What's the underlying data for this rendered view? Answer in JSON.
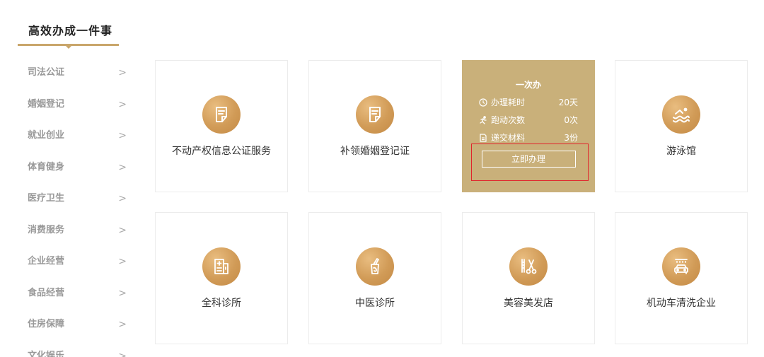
{
  "header": {
    "title": "高效办成一件事"
  },
  "sidebar": {
    "items": [
      {
        "label": "司法公证"
      },
      {
        "label": "婚姻登记"
      },
      {
        "label": "就业创业"
      },
      {
        "label": "体育健身"
      },
      {
        "label": "医疗卫生"
      },
      {
        "label": "消费服务"
      },
      {
        "label": "企业经营"
      },
      {
        "label": "食品经营"
      },
      {
        "label": "住房保障"
      },
      {
        "label": "文化娱乐"
      }
    ],
    "chevron": ">"
  },
  "cards": [
    {
      "label": "不动产权信息公证服务",
      "icon": "document-icon"
    },
    {
      "label": "补领婚姻登记证",
      "icon": "document-icon"
    },
    {
      "active": true,
      "title": "一次办",
      "rows": [
        {
          "label": "办理耗时",
          "value": "20天",
          "icon": "clock-icon"
        },
        {
          "label": "跑动次数",
          "value": "0次",
          "icon": "running-icon"
        },
        {
          "label": "递交材料",
          "value": "3份",
          "icon": "file-icon"
        }
      ],
      "button": "立即办理"
    },
    {
      "label": "游泳馆",
      "icon": "swimming-icon"
    },
    {
      "label": "全科诊所",
      "icon": "clinic-icon"
    },
    {
      "label": "中医诊所",
      "icon": "herbal-medicine-icon"
    },
    {
      "label": "美容美发店",
      "icon": "scissors-icon"
    },
    {
      "label": "机动车清洗企业",
      "icon": "car-wash-icon"
    }
  ],
  "colors": {
    "accent": "#c9a66b",
    "active_card": "#c9b07a",
    "highlight": "#e0242c"
  }
}
